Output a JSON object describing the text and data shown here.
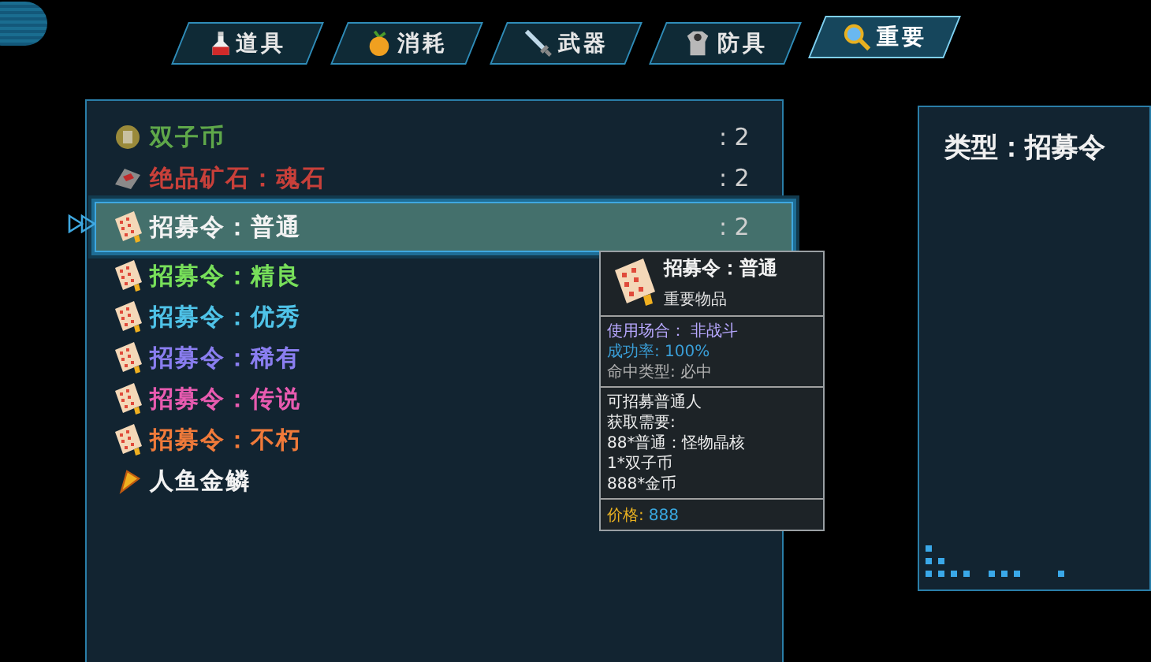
{
  "tabs": [
    {
      "label": "道具",
      "selected": false
    },
    {
      "label": "消耗",
      "selected": false
    },
    {
      "label": "武器",
      "selected": false
    },
    {
      "label": "防具",
      "selected": false
    },
    {
      "label": "重要",
      "selected": true
    }
  ],
  "items": [
    {
      "name": "双子币",
      "kind": "coin",
      "color": "#5fa84a",
      "count": ": 2",
      "selected": false
    },
    {
      "name": "绝品矿石：魂石",
      "kind": "ore",
      "color": "#c8403a",
      "count": ": 2",
      "selected": false
    },
    {
      "name": "招募令：普通",
      "kind": "scroll",
      "color": "#f2f2f2",
      "count": ": 2",
      "selected": true
    },
    {
      "name": "招募令：精良",
      "kind": "scroll",
      "color": "#78e05a",
      "selected": false
    },
    {
      "name": "招募令：优秀",
      "kind": "scroll",
      "color": "#4fc3e8",
      "selected": false
    },
    {
      "name": "招募令：稀有",
      "kind": "scroll",
      "color": "#8a7ef0",
      "selected": false
    },
    {
      "name": "招募令：传说",
      "kind": "scroll",
      "color": "#e85bb0",
      "selected": false
    },
    {
      "name": "招募令：不朽",
      "kind": "scroll",
      "color": "#f07a3a",
      "selected": false
    },
    {
      "name": "人鱼金鳞",
      "kind": "scale",
      "color": "#f2f2f2",
      "selected": false
    }
  ],
  "tooltip": {
    "title": "招募令：普通",
    "subtitle": "重要物品",
    "stats": [
      {
        "text": "使用场合：  非战斗",
        "color": "#b8a8ff"
      },
      {
        "text": "成功率: 100%",
        "color": "#3a9fd8"
      },
      {
        "text": "命中类型: 必中",
        "color": "#b0b0b0"
      }
    ],
    "description": [
      "可招募普通人",
      "获取需要:",
      "88*普通：怪物晶核",
      "1*双子币",
      "888*金币"
    ],
    "price_label": "价格:",
    "price": "888"
  },
  "detail": {
    "title": "类型：招募令"
  }
}
